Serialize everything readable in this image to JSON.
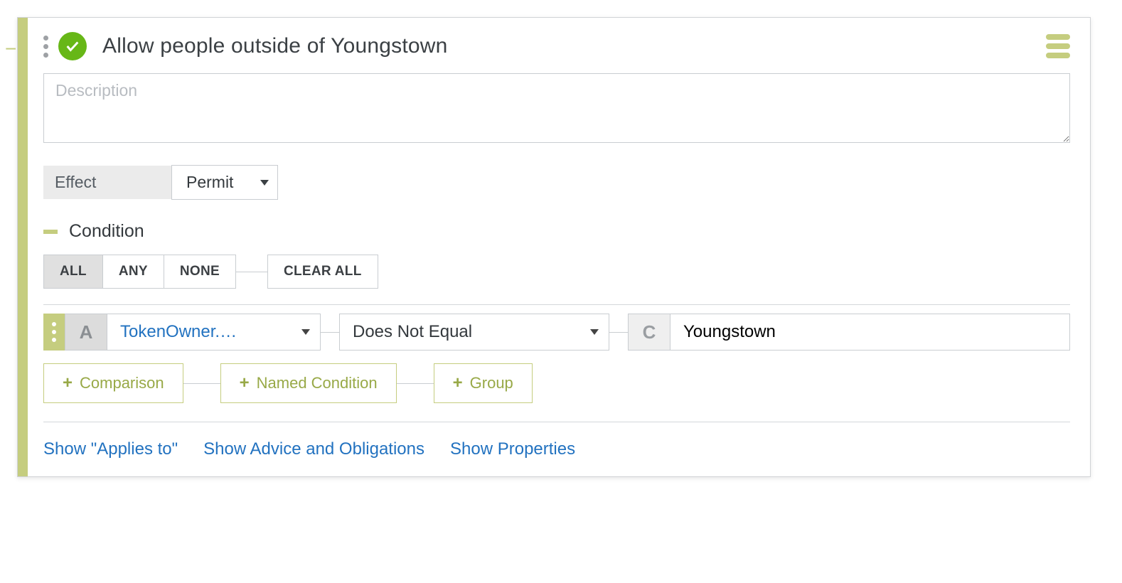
{
  "rule": {
    "title": "Allow people outside of Youngstown",
    "descriptionPlaceholder": "Description",
    "effectLabel": "Effect",
    "effectValue": "Permit",
    "conditionHeading": "Condition",
    "operators": {
      "all": "ALL",
      "any": "ANY",
      "none": "NONE"
    },
    "clearAll": "CLEAR ALL",
    "comparison": {
      "leftTag": "A",
      "attribute": "TokenOwner.…",
      "operator": "Does Not Equal",
      "rightTag": "C",
      "value": "Youngstown"
    },
    "addButtons": {
      "comparison": "Comparison",
      "named": "Named Condition",
      "group": "Group"
    },
    "links": {
      "appliesTo": "Show \"Applies to\"",
      "advice": "Show Advice and Obligations",
      "properties": "Show Properties"
    }
  }
}
